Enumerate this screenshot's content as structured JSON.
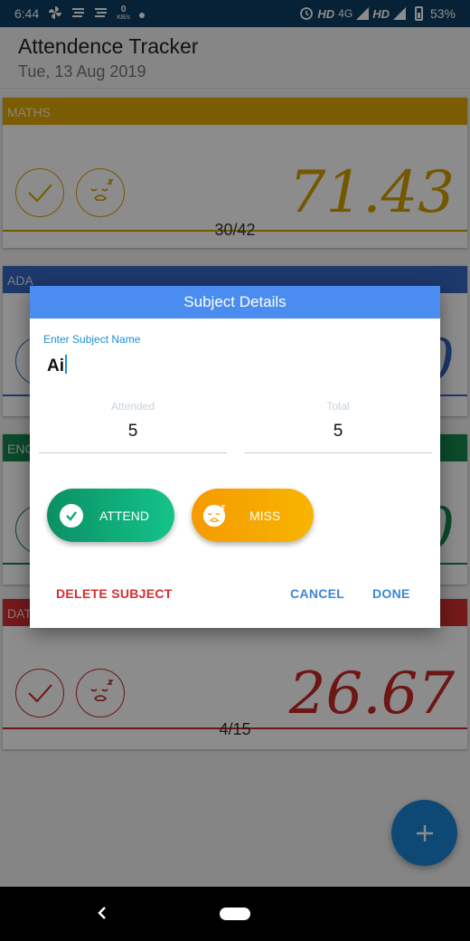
{
  "status_bar": {
    "time": "6:44",
    "kbs_value": "0",
    "kbs_unit": "KB/s",
    "hd1": "HD",
    "net": "4G",
    "hd2": "HD",
    "battery": "53%"
  },
  "app": {
    "title": "Attendence Tracker",
    "date": "Tue, 13 Aug 2019"
  },
  "subjects": [
    {
      "name": "MATHS",
      "percent": "71.43",
      "ratio": "30/42",
      "color": "#d4a000"
    },
    {
      "name": "ADA",
      "percent": "0",
      "ratio": "",
      "color": "#3566c4"
    },
    {
      "name": "ENG",
      "percent": "0",
      "ratio": "",
      "color": "#15874e"
    },
    {
      "name": "DATA",
      "percent": "26.67",
      "ratio": "4/15",
      "color": "#c62828"
    }
  ],
  "dialog": {
    "title": "Subject Details",
    "name_label": "Enter Subject Name",
    "name_value": "Ai",
    "attended_label": "Attended",
    "attended_value": "5",
    "total_label": "Total",
    "total_value": "5",
    "attend_label": "ATTEND",
    "miss_label": "MISS",
    "delete_label": "DELETE SUBJECT",
    "cancel_label": "CANCEL",
    "done_label": "DONE"
  },
  "colors": {
    "dialog_header": "#4a8cf0",
    "attend": "#0fa877",
    "miss": "#f5a000",
    "delete": "#d32f2f",
    "action": "#3c86d6",
    "fab": "#1a86d6"
  },
  "icons": {
    "fab": "plus-icon",
    "attend": "check-icon",
    "miss": "sleepy-face-icon"
  }
}
